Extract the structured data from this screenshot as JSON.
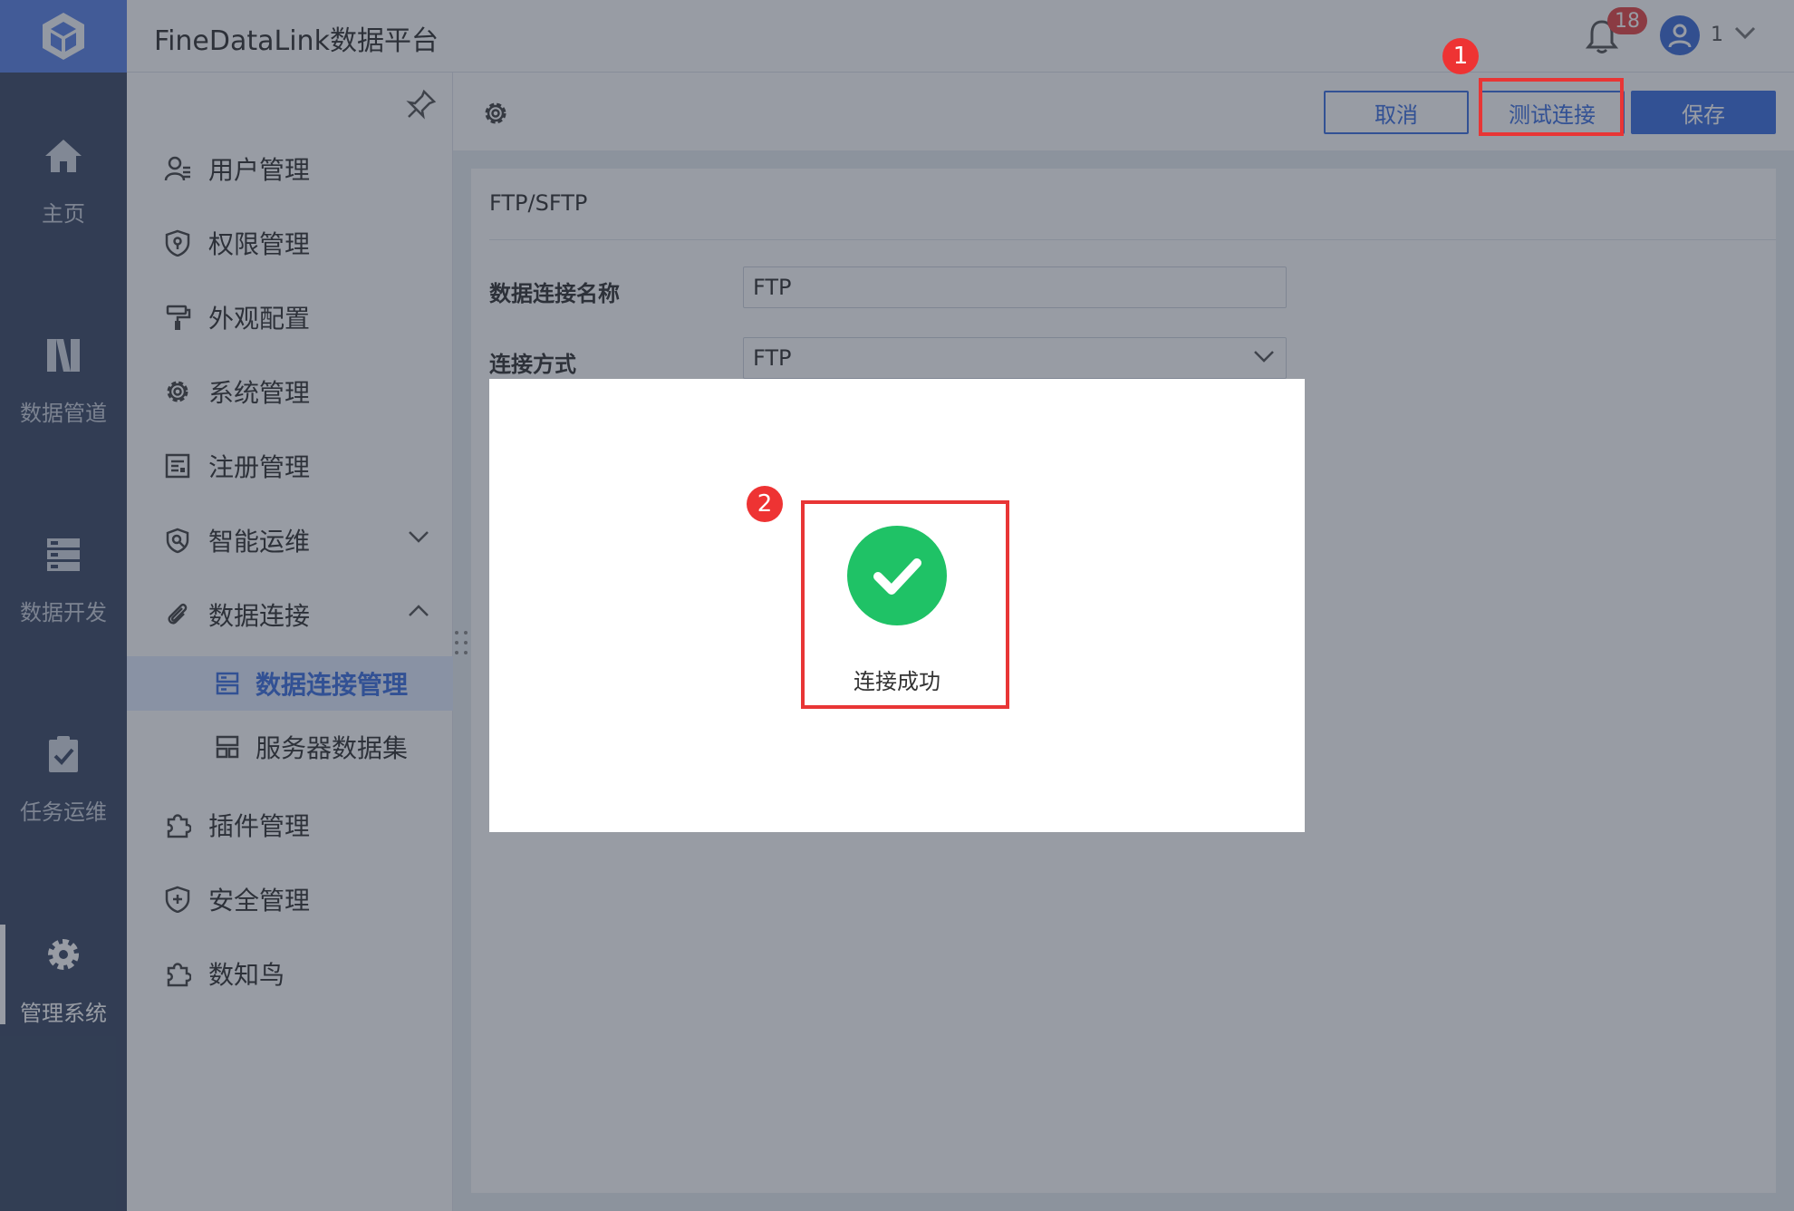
{
  "app": {
    "title": "FineDataLink数据平台"
  },
  "topbar": {
    "notification_count": "18",
    "user_name": "1"
  },
  "rail": {
    "items": [
      {
        "label": "主页",
        "icon": "home-icon"
      },
      {
        "label": "数据管道",
        "icon": "pipeline-icon"
      },
      {
        "label": "数据开发",
        "icon": "dev-icon"
      },
      {
        "label": "任务运维",
        "icon": "task-icon"
      },
      {
        "label": "管理系统",
        "icon": "gear-icon",
        "active": true
      }
    ]
  },
  "menu": {
    "items": [
      {
        "label": "用户管理",
        "icon": "user-icon"
      },
      {
        "label": "权限管理",
        "icon": "shield-key-icon"
      },
      {
        "label": "外观配置",
        "icon": "paint-roller-icon"
      },
      {
        "label": "系统管理",
        "icon": "gear-icon"
      },
      {
        "label": "注册管理",
        "icon": "register-icon"
      },
      {
        "label": "智能运维",
        "icon": "smart-ops-icon",
        "expandable": true,
        "expanded": false
      },
      {
        "label": "数据连接",
        "icon": "paperclip-icon",
        "expandable": true,
        "expanded": true
      },
      {
        "label": "插件管理",
        "icon": "puzzle-icon"
      },
      {
        "label": "安全管理",
        "icon": "shield-plus-icon"
      },
      {
        "label": "数知鸟",
        "icon": "puzzle-icon"
      }
    ],
    "sub_items": [
      {
        "label": "数据连接管理",
        "icon": "db-connection-icon",
        "active": true
      },
      {
        "label": "服务器数据集",
        "icon": "server-dataset-icon"
      }
    ]
  },
  "toolbar": {
    "cancel_label": "取消",
    "test_label": "测试连接",
    "save_label": "保存"
  },
  "form": {
    "section_title": "FTP/SFTP",
    "name_label": "数据连接名称",
    "name_value": "FTP",
    "method_label": "连接方式",
    "method_value": "FTP"
  },
  "modal": {
    "message": "连接成功"
  },
  "annotations": {
    "step1": "1",
    "step2": "2"
  },
  "colors": {
    "primary": "#3d6fe0",
    "success": "#1fc266",
    "highlight": "#e83535",
    "rail": "#3c4a66"
  }
}
